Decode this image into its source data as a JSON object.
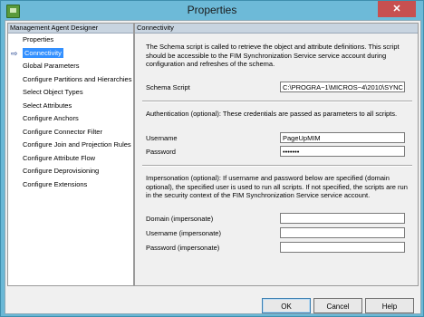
{
  "window": {
    "title": "Properties",
    "close_glyph": "✕"
  },
  "left_pane": {
    "header": "Management Agent Designer",
    "items": [
      {
        "label": "Properties"
      },
      {
        "label": "Connectivity",
        "selected": true
      },
      {
        "label": "Global Parameters"
      },
      {
        "label": "Configure Partitions and Hierarchies"
      },
      {
        "label": "Select Object Types"
      },
      {
        "label": "Select Attributes"
      },
      {
        "label": "Configure Anchors"
      },
      {
        "label": "Configure Connector Filter"
      },
      {
        "label": "Configure Join and Projection Rules"
      },
      {
        "label": "Configure Attribute Flow"
      },
      {
        "label": "Configure Deprovisioning"
      },
      {
        "label": "Configure Extensions"
      }
    ]
  },
  "right_pane": {
    "header": "Connectivity",
    "schema_desc": "The Schema script is called to retrieve the object and attribute definitions. This script should be accessible to the FIM Synchronization Service service account during configuration and refreshes of the schema.",
    "schema_label": "Schema Script",
    "schema_value": "C:\\PROGRA~1\\MICROS~4\\2010\\SYNC",
    "auth_desc": "Authentication (optional): These credentials are passed as parameters to all scripts.",
    "username_label": "Username",
    "username_value": "PageUpMIM",
    "password_label": "Password",
    "password_value": "•••••••",
    "imp_desc": "Impersonation (optional): If username and password below are specified (domain optional), the specified user is used to run all scripts. If not specified, the scripts are run in the security context of the FIM Synchronization Service service account.",
    "domain_label": "Domain (impersonate)",
    "imp_username_label": "Username (impersonate)",
    "imp_password_label": "Password  (impersonate)"
  },
  "buttons": {
    "ok": "OK",
    "cancel": "Cancel",
    "help": "Help"
  }
}
